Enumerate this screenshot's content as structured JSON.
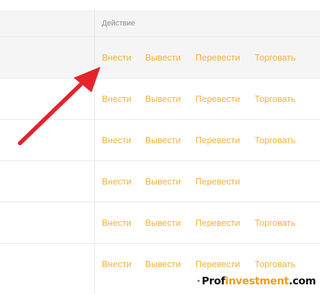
{
  "table": {
    "action_header": "Действие",
    "rows": [
      {
        "deposit": "Внести",
        "withdraw": "Вывести",
        "transfer": "Перевести",
        "trade": "Торговать"
      },
      {
        "deposit": "Внести",
        "withdraw": "Вывести",
        "transfer": "Перевести",
        "trade": "Торговать"
      },
      {
        "deposit": "Внести",
        "withdraw": "Вывести",
        "transfer": "Перевести",
        "trade": "Торговать"
      },
      {
        "deposit": "Внести",
        "withdraw": "Вывести",
        "transfer": "Перевести"
      },
      {
        "deposit": "Внести",
        "withdraw": "Вывести",
        "transfer": "Перевести",
        "trade": "Торговать"
      },
      {
        "deposit": "Внести",
        "withdraw": "Вывести",
        "transfer": "Перевести",
        "trade": "Торговать"
      }
    ]
  },
  "watermark": {
    "prefix": "Prof",
    "accent": "investment",
    "suffix": ".com"
  },
  "colors": {
    "action_link": "#f3b23a",
    "arrow": "#e4232b",
    "header_bg": "#f5f5f5",
    "watermark_accent": "#f39c12"
  },
  "icons": {
    "annotation": "red-arrow-icon",
    "watermark_logo": "hexagon-logo-icon"
  }
}
